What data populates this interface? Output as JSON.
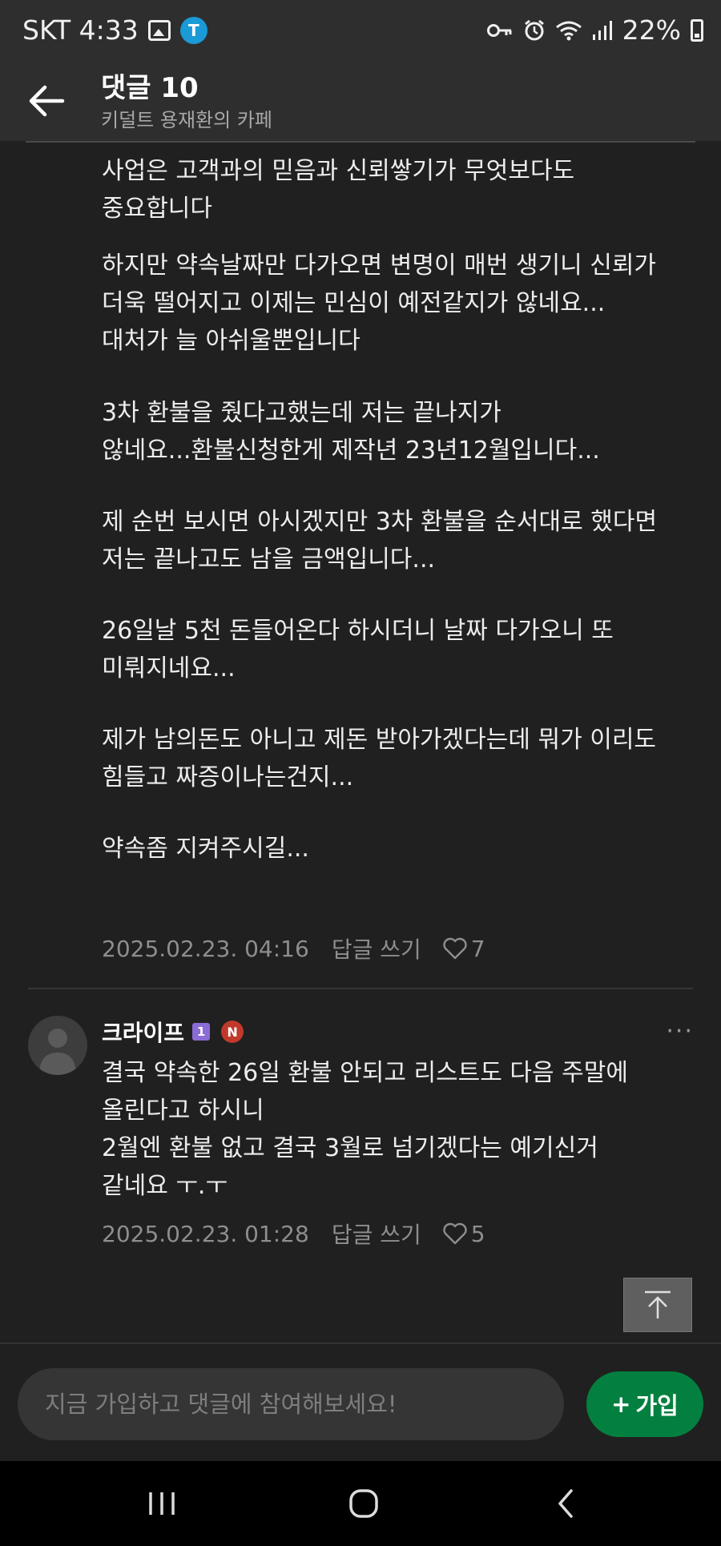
{
  "status_bar": {
    "carrier_time": "SKT 4:33",
    "app_icon_label": "T",
    "battery": "22%",
    "icons": [
      "image-icon",
      "app-icon",
      "key-icon",
      "alarm-icon",
      "wifi-icon",
      "signal-icon",
      "battery-icon"
    ]
  },
  "header": {
    "title": "댓글 10",
    "subtitle": "키덜트 용재환의 카페"
  },
  "comment1": {
    "paragraphs": [
      "사업은 고객과의 믿음과 신뢰쌓기가 무엇보다도\n중요합니다",
      "하지만 약속날짜만 다가오면 변명이 매번 생기니 신뢰가\n더욱 떨어지고 이제는 민심이 예전같지가 않네요...\n대처가 늘 아쉬울뿐입니다",
      "3차 환불을 줬다고했는데 저는 끝나지가\n않네요...환불신청한게 제작년 23년12월입니다...",
      "제 순번 보시면 아시겠지만 3차 환불을 순서대로 했다면\n저는 끝나고도 남을 금액입니다...",
      "26일날 5천 돈들어온다 하시더니 날짜 다가오니 또\n미뤄지네요...",
      "제가 남의돈도 아니고 제돈 받아가겠다는데 뭐가 이리도\n힘들고 짜증이나는건지...",
      "약속좀 지켜주시길..."
    ],
    "date": "2025.02.23. 04:16",
    "reply_label": "답글 쓰기",
    "likes": "7"
  },
  "comment2": {
    "author": "크라이프",
    "level_badge": "1",
    "n_badge": "N",
    "more": "···",
    "text": "결국 약속한 26일 환불 안되고 리스트도 다음 주말에\n올린다고 하시니\n2월엔 환불 없고 결국 3월로 넘기겠다는 예기신거\n같네요 ㅜ.ㅜ",
    "date": "2025.02.23. 01:28",
    "reply_label": "답글 쓰기",
    "likes": "5"
  },
  "bottom": {
    "input_placeholder": "지금 가입하고 댓글에 참여해보세요!",
    "join_plus": "+",
    "join_label": "가입"
  },
  "colors": {
    "background": "#202020",
    "header": "#2e2e2e",
    "join_button": "#03803f",
    "meta_text": "#8e8e8e"
  }
}
